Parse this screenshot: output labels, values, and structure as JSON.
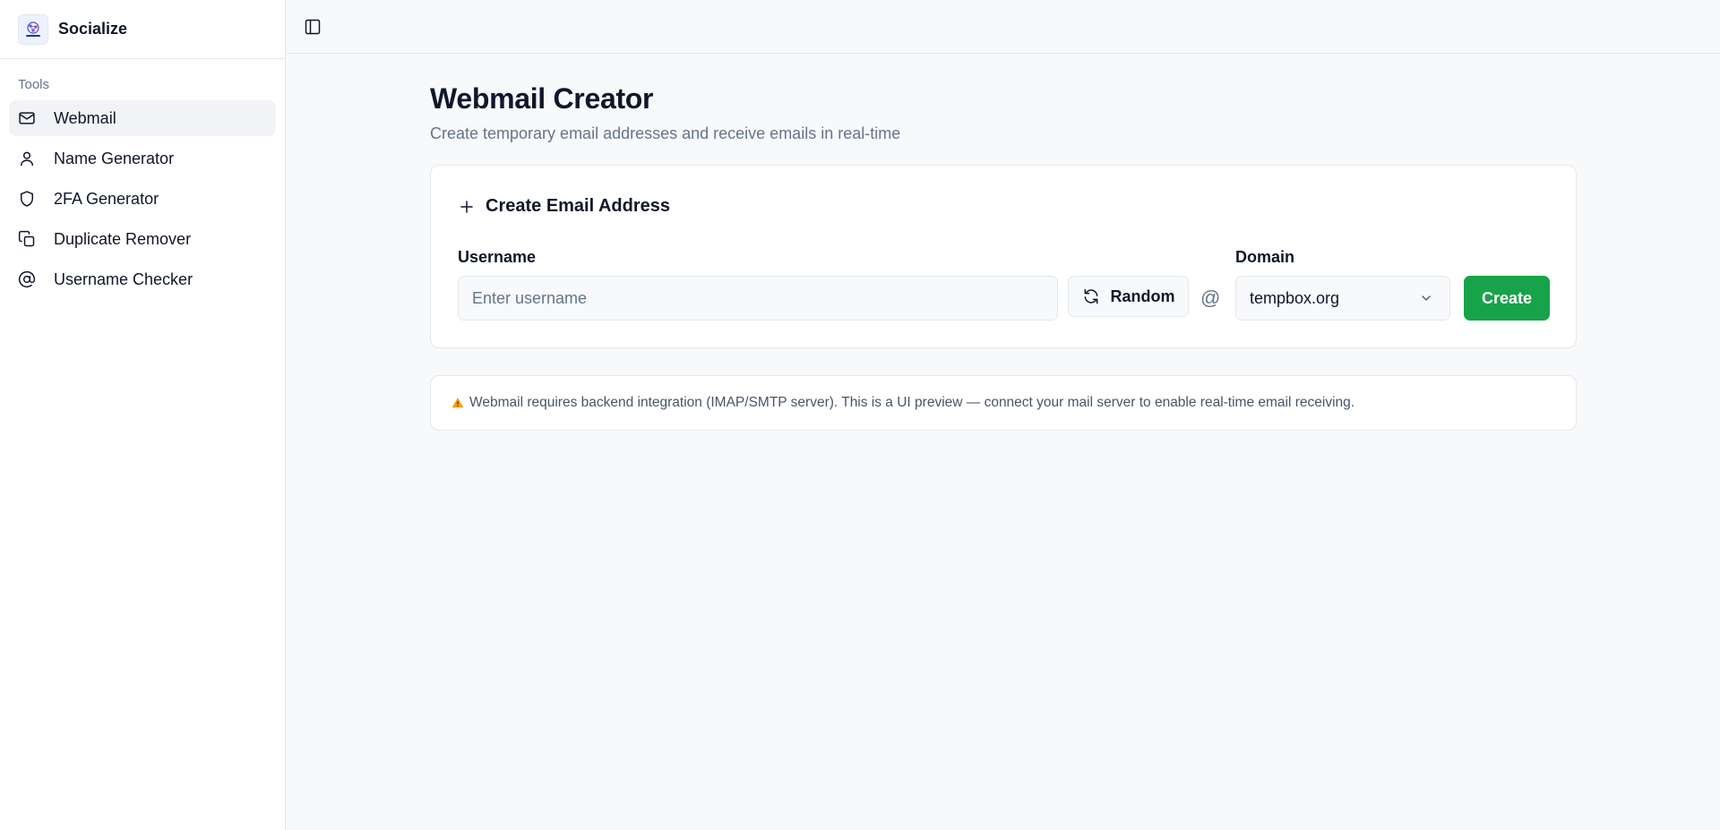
{
  "brand": {
    "name": "Socialize",
    "logo_icon": "globe-network-logo"
  },
  "sidebar": {
    "section_label": "Tools",
    "items": [
      {
        "label": "Webmail",
        "icon": "mail-icon",
        "active": true
      },
      {
        "label": "Name Generator",
        "icon": "user-icon",
        "active": false
      },
      {
        "label": "2FA Generator",
        "icon": "shield-icon",
        "active": false
      },
      {
        "label": "Duplicate Remover",
        "icon": "copy-icon",
        "active": false
      },
      {
        "label": "Username Checker",
        "icon": "at-sign-icon",
        "active": false
      }
    ]
  },
  "topbar": {
    "toggle_icon": "sidebar-toggle-icon"
  },
  "page": {
    "title": "Webmail Creator",
    "subtitle": "Create temporary email addresses and receive emails in real-time"
  },
  "create_card": {
    "title": "Create Email Address",
    "username_label": "Username",
    "username_placeholder": "Enter username",
    "username_value": "",
    "random_label": "Random",
    "at_symbol": "@",
    "domain_label": "Domain",
    "domain_value": "tempbox.org",
    "create_label": "Create"
  },
  "notice": {
    "icon": "⚠️",
    "text": "Webmail requires backend integration (IMAP/SMTP server). This is a UI preview — connect your mail server to enable real-time email receiving."
  },
  "colors": {
    "accent_green": "#16a34a",
    "active_nav_bg": "#f1f3f7",
    "muted_text": "#64748b",
    "warning": "#f59e0b"
  }
}
